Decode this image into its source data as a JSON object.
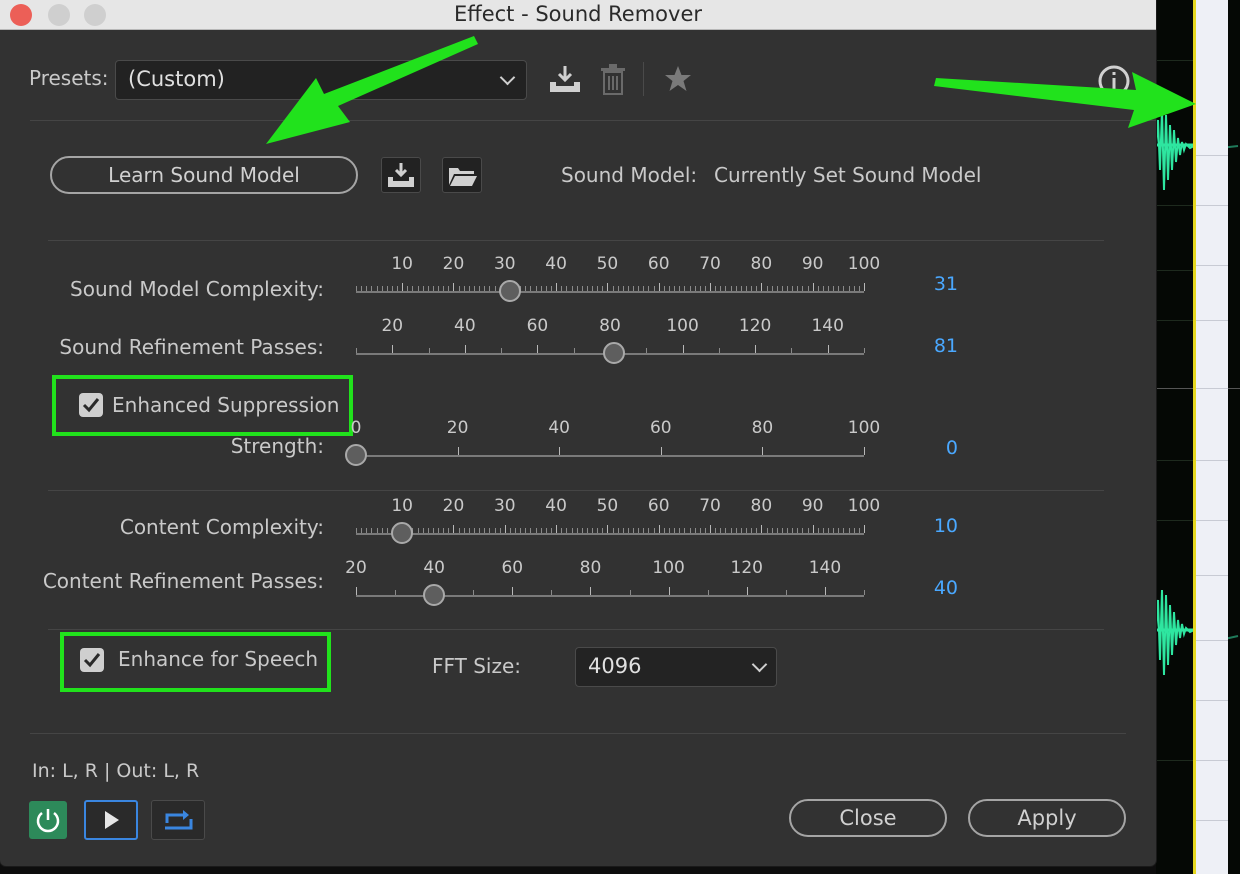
{
  "window": {
    "title": "Effect - Sound Remover"
  },
  "presets": {
    "label": "Presets:",
    "value": "(Custom)"
  },
  "sound_model": {
    "learn_button": "Learn Sound Model",
    "label": "Sound Model:",
    "value": "Currently Set Sound Model"
  },
  "sliders": {
    "sound_model_complexity": {
      "label": "Sound Model Complexity:",
      "value": "31",
      "ticks": [
        "10",
        "20",
        "30",
        "40",
        "50",
        "60",
        "70",
        "80",
        "90",
        "100"
      ]
    },
    "sound_refinement_passes": {
      "label": "Sound Refinement Passes:",
      "value": "81",
      "ticks": [
        "20",
        "40",
        "60",
        "80",
        "100",
        "120",
        "140"
      ]
    },
    "strength": {
      "label": "Strength:",
      "value": "0",
      "ticks": [
        "0",
        "20",
        "40",
        "60",
        "80",
        "100"
      ]
    },
    "content_complexity": {
      "label": "Content Complexity:",
      "value": "10",
      "ticks": [
        "10",
        "20",
        "30",
        "40",
        "50",
        "60",
        "70",
        "80",
        "90",
        "100"
      ]
    },
    "content_refinement_passes": {
      "label": "Content Refinement Passes:",
      "value": "40",
      "ticks": [
        "20",
        "40",
        "60",
        "80",
        "100",
        "120",
        "140"
      ]
    }
  },
  "enhanced_suppression": {
    "label": "Enhanced Suppression",
    "checked": true
  },
  "enhance_for_speech": {
    "label": "Enhance for Speech",
    "checked": true
  },
  "fft": {
    "label": "FFT Size:",
    "value": "4096"
  },
  "io": {
    "text": "In: L, R | Out: L, R"
  },
  "footer": {
    "close": "Close",
    "apply": "Apply"
  },
  "colors": {
    "accent_value": "#4aa8ff",
    "annotation": "#21e21c",
    "waveform": "#2ee6a0",
    "power_on": "#2d8a5a"
  }
}
